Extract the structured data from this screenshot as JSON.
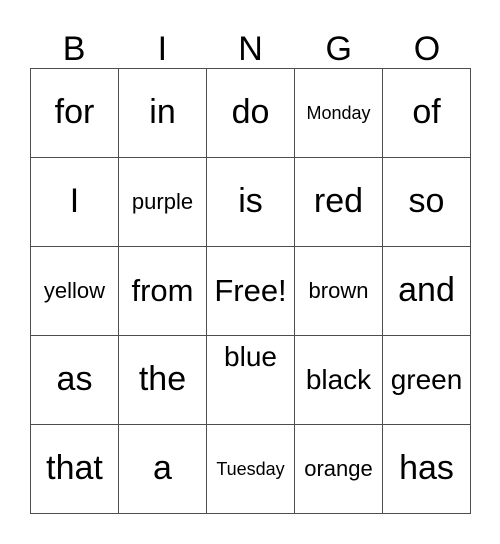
{
  "card": {
    "title_letters": [
      "B",
      "I",
      "N",
      "G",
      "O"
    ],
    "free_space_label": "Free!",
    "colors": {
      "background": "#ffffff",
      "border": "#4d4d4d",
      "text": "#000000"
    },
    "grid": {
      "columns": 5,
      "rows": 5,
      "cells": [
        [
          {
            "text": "for",
            "size": "xl",
            "align": "middle"
          },
          {
            "text": "in",
            "size": "xl",
            "align": "middle"
          },
          {
            "text": "do",
            "size": "xl",
            "align": "middle"
          },
          {
            "text": "Monday",
            "size": "xs",
            "align": "middle"
          },
          {
            "text": "of",
            "size": "xl",
            "align": "middle"
          }
        ],
        [
          {
            "text": "I",
            "size": "xl",
            "align": "middle"
          },
          {
            "text": "purple",
            "size": "s",
            "align": "middle"
          },
          {
            "text": "is",
            "size": "xl",
            "align": "middle"
          },
          {
            "text": "red",
            "size": "xl",
            "align": "middle"
          },
          {
            "text": "so",
            "size": "xl",
            "align": "middle"
          }
        ],
        [
          {
            "text": "yellow",
            "size": "s",
            "align": "middle"
          },
          {
            "text": "from",
            "size": "l",
            "align": "middle"
          },
          {
            "text": "Free!",
            "size": "l",
            "align": "middle"
          },
          {
            "text": "brown",
            "size": "s",
            "align": "middle"
          },
          {
            "text": "and",
            "size": "xl",
            "align": "middle"
          }
        ],
        [
          {
            "text": "as",
            "size": "xl",
            "align": "middle"
          },
          {
            "text": "the",
            "size": "xl",
            "align": "middle"
          },
          {
            "text": "blue",
            "size": "ml",
            "align": "top"
          },
          {
            "text": "black",
            "size": "ml",
            "align": "middle"
          },
          {
            "text": "green",
            "size": "ml",
            "align": "middle"
          }
        ],
        [
          {
            "text": "that",
            "size": "xl",
            "align": "middle"
          },
          {
            "text": "a",
            "size": "xl",
            "align": "middle"
          },
          {
            "text": "Tuesday",
            "size": "xs",
            "align": "middle"
          },
          {
            "text": "orange",
            "size": "s",
            "align": "middle"
          },
          {
            "text": "has",
            "size": "xl",
            "align": "middle"
          }
        ]
      ]
    }
  }
}
